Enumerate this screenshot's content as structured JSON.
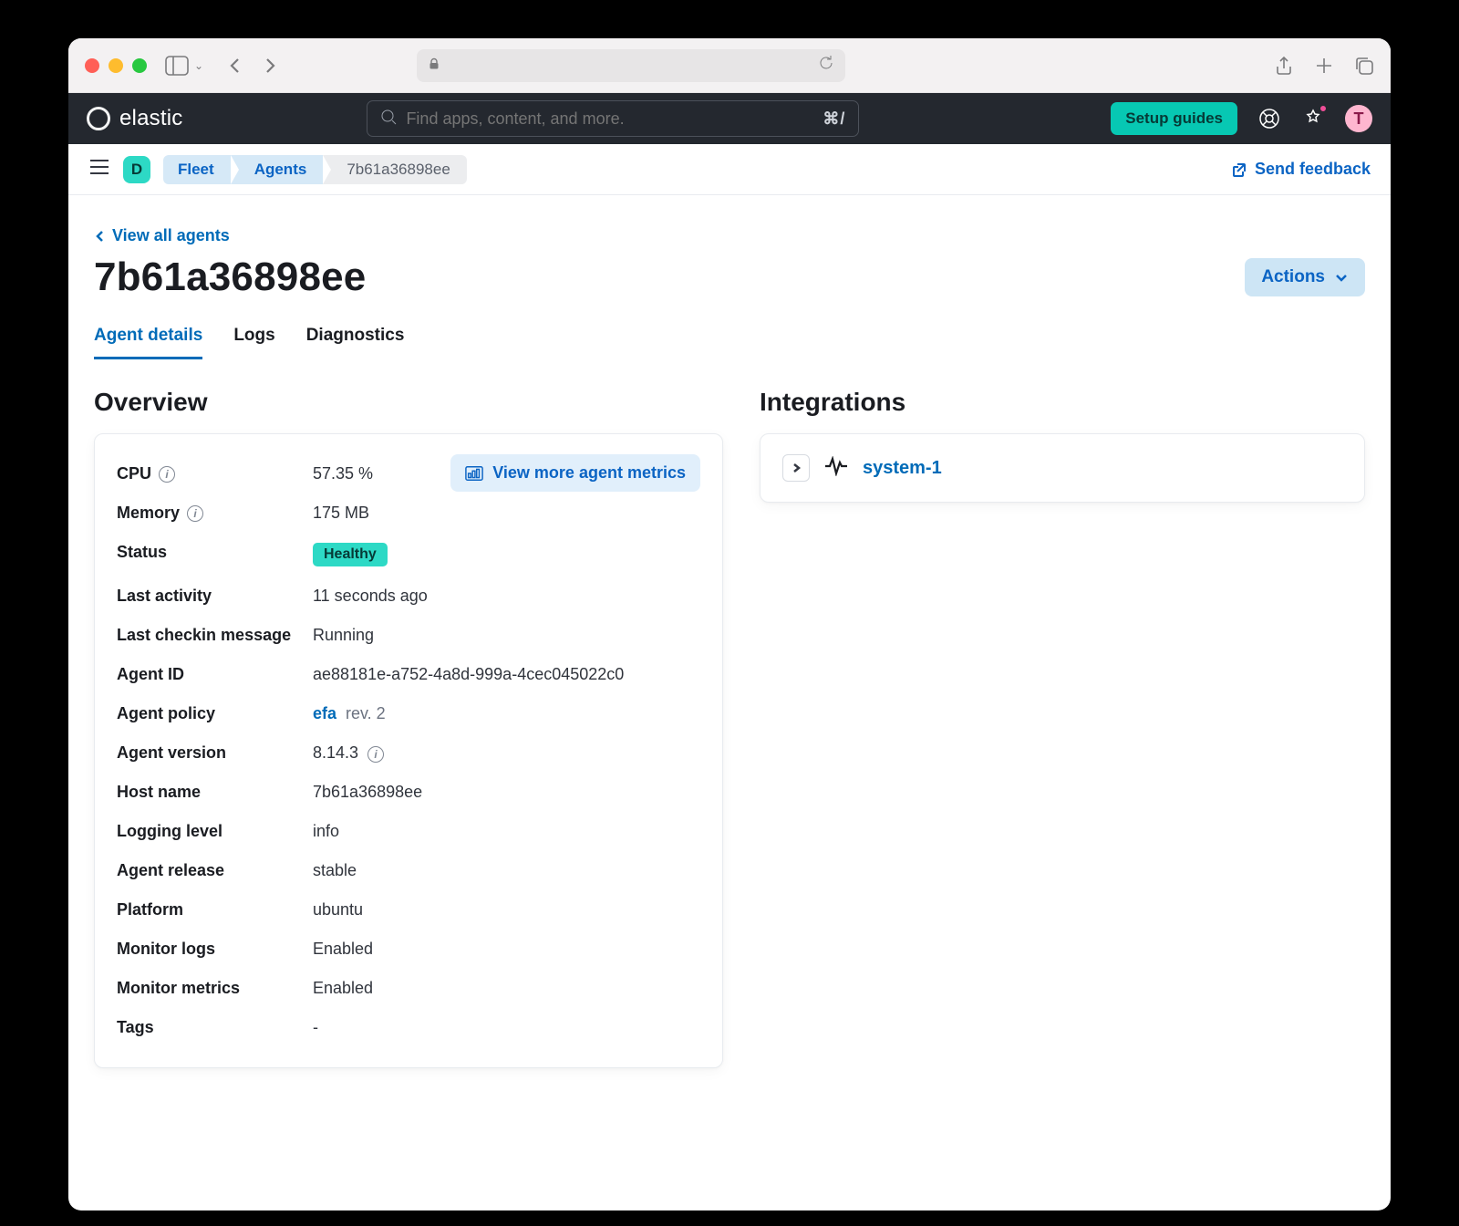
{
  "browser": {},
  "header": {
    "brand": "elastic",
    "search_placeholder": "Find apps, content, and more.",
    "search_shortcut": "⌘/",
    "setup_guides": "Setup guides",
    "avatar_initial": "T"
  },
  "subheader": {
    "space_initial": "D",
    "breadcrumbs": [
      "Fleet",
      "Agents",
      "7b61a36898ee"
    ],
    "send_feedback": "Send feedback"
  },
  "page": {
    "back_link": "View all agents",
    "title": "7b61a36898ee",
    "actions_label": "Actions",
    "tabs": [
      "Agent details",
      "Logs",
      "Diagnostics"
    ],
    "active_tab_index": 0,
    "overview_heading": "Overview",
    "integrations_heading": "Integrations",
    "view_more_metrics": "View more agent metrics"
  },
  "overview": {
    "rows": [
      {
        "label": "CPU",
        "value": "57.35 %",
        "info": true
      },
      {
        "label": "Memory",
        "value": "175 MB",
        "info": true
      },
      {
        "label": "Status",
        "value": "Healthy",
        "badge": true
      },
      {
        "label": "Last activity",
        "value": "11 seconds ago"
      },
      {
        "label": "Last checkin message",
        "value": "Running"
      },
      {
        "label": "Agent ID",
        "value": "ae88181e-a752-4a8d-999a-4cec045022c0"
      },
      {
        "label": "Agent policy",
        "value_link": "efa",
        "value_suffix": "rev. 2"
      },
      {
        "label": "Agent version",
        "value": "8.14.3",
        "info_after": true
      },
      {
        "label": "Host name",
        "value": "7b61a36898ee"
      },
      {
        "label": "Logging level",
        "value": "info"
      },
      {
        "label": "Agent release",
        "value": "stable"
      },
      {
        "label": "Platform",
        "value": "ubuntu"
      },
      {
        "label": "Monitor logs",
        "value": "Enabled"
      },
      {
        "label": "Monitor metrics",
        "value": "Enabled"
      },
      {
        "label": "Tags",
        "value": "-"
      }
    ]
  },
  "integrations": [
    {
      "name": "system-1"
    }
  ]
}
